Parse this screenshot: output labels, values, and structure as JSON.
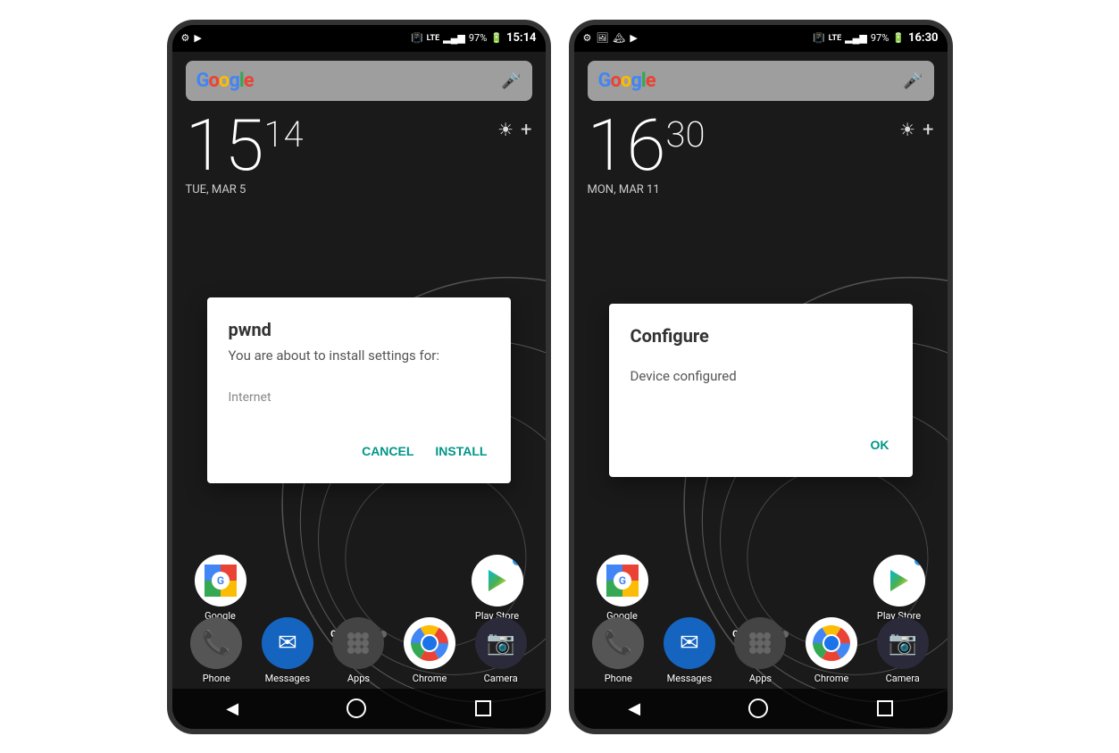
{
  "phone1": {
    "status": {
      "time": "15:14",
      "battery": "97%",
      "network": "LTE"
    },
    "clock": {
      "hour": "15",
      "minute": "14",
      "date": "TUE, MAR 5"
    },
    "dialog": {
      "title": "pwnd",
      "subtitle": "You are about to install settings for:",
      "content": "Internet",
      "cancel_label": "CANCEL",
      "install_label": "INSTALL"
    },
    "apps": {
      "google_label": "Google",
      "playstore_label": "Play Store",
      "phone_label": "Phone",
      "messages_label": "Messages",
      "apps_label": "Apps",
      "chrome_label": "Chrome",
      "camera_label": "Camera"
    }
  },
  "phone2": {
    "status": {
      "time": "16:30",
      "battery": "97%",
      "network": "LTE"
    },
    "clock": {
      "hour": "16",
      "minute": "30",
      "date": "MON, MAR 11"
    },
    "dialog": {
      "title": "Configure",
      "content": "Device configured",
      "ok_label": "OK"
    },
    "apps": {
      "google_label": "Google",
      "playstore_label": "Play Store",
      "phone_label": "Phone",
      "messages_label": "Messages",
      "apps_label": "Apps",
      "chrome_label": "Chrome",
      "camera_label": "Camera"
    }
  }
}
